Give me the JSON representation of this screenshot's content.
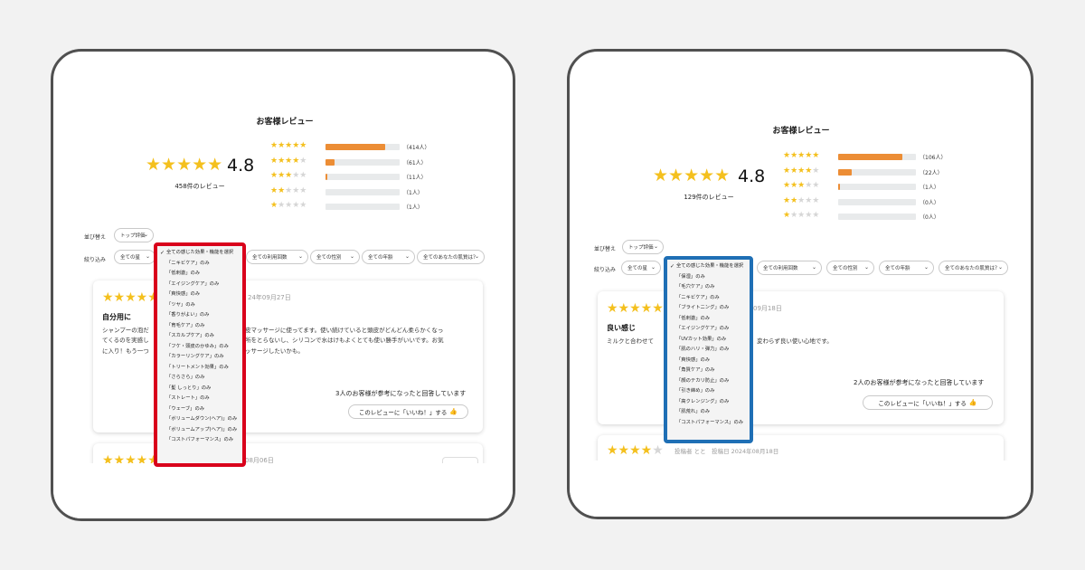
{
  "left": {
    "title": "お客様レビュー",
    "average": "4.8",
    "review_count": "458件のレビュー",
    "distribution": [
      {
        "stars": 5,
        "label": "（414人）",
        "fraction": 0.81
      },
      {
        "stars": 4,
        "label": "（61人）",
        "fraction": 0.12
      },
      {
        "stars": 3,
        "label": "（11人）",
        "fraction": 0.02
      },
      {
        "stars": 2,
        "label": "（1人）",
        "fraction": 0
      },
      {
        "stars": 1,
        "label": "（1人）",
        "fraction": 0
      }
    ],
    "sort_label": "並び替え",
    "sort_value": "トップ評価",
    "filter_label": "絞り込み",
    "filters": [
      "全ての星",
      "全ての利用回数",
      "全ての性別",
      "全ての年齢",
      "全てのあなたの肌質は？"
    ],
    "dropdown_items": [
      "全ての感じた効果・機能を選択",
      "「ニキビケア」のみ",
      "「低刺激」のみ",
      "「エイジングケア」のみ",
      "「爽快感」のみ",
      "「ツヤ」のみ",
      "「香りがよい」のみ",
      "「育毛ケア」のみ",
      "「スカルプケア」のみ",
      "「フケ・頭皮のかゆみ」のみ",
      "「カラーリングケア」のみ",
      "「トリートメント効果」のみ",
      "「さらさら」のみ",
      "「髪 しっとり」のみ",
      "「ストレート」のみ",
      "「ウェーブ」のみ",
      "「ボリュームダウン(ヘア)」のみ",
      "「ボリュームアップ(ヘア)」のみ",
      "「コストパフォーマンス」のみ"
    ],
    "review1": {
      "date": "24年09月27日",
      "title": "自分用に",
      "body_a": "シャンプーの泡だ",
      "body_b": "てくるのを実感し",
      "body_c": "に入り！もう一つ",
      "body_r1": "皮マッサージに使ってます。使い続けていると頭皮がどんどん柔らかくなっ",
      "body_r2": "所をとらないし、シリコンで水はけもよくとても使い勝手がいいです。お気",
      "body_r3": "ッサージしたいかも。",
      "helpful": "3人のお客様が参考になったと回答しています",
      "like": "このレビューに「いいね！」する",
      "rating": 5
    },
    "review2": {
      "date": "08月06日",
      "rating": 5
    }
  },
  "right": {
    "title": "お客様レビュー",
    "average": "4.8",
    "review_count": "129件のレビュー",
    "distribution": [
      {
        "stars": 5,
        "label": "（106人）",
        "fraction": 0.82
      },
      {
        "stars": 4,
        "label": "（22人）",
        "fraction": 0.17
      },
      {
        "stars": 3,
        "label": "（1人）",
        "fraction": 0.01
      },
      {
        "stars": 2,
        "label": "（0人）",
        "fraction": 0
      },
      {
        "stars": 1,
        "label": "（0人）",
        "fraction": 0
      }
    ],
    "sort_label": "並び替え",
    "sort_value": "トップ評価",
    "filter_label": "絞り込み",
    "filters": [
      "全ての星",
      "全ての利用回数",
      "全ての性別",
      "全ての年齢",
      "全てのあなたの肌質は？"
    ],
    "dropdown_items": [
      "全ての感じた効果・機能を選択",
      "「保湿」のみ",
      "「毛穴ケア」のみ",
      "「ニキビケア」のみ",
      "「ブライトニング」のみ",
      "「低刺激」のみ",
      "「エイジングケア」のみ",
      "「UVカット効果」のみ",
      "「肌のハリ・弾力」のみ",
      "「爽快感」のみ",
      "「角質ケア」のみ",
      "「顔のテカリ防止」のみ",
      "「引き締め」のみ",
      "「高クレンジング」のみ",
      "「肌荒れ」のみ",
      "「コストパフォーマンス」のみ"
    ],
    "review1": {
      "date": "09月18日",
      "title": "良い感じ",
      "body_a": "ミルクと合わせて",
      "body_r1": "変わらず良い使い心地です。",
      "helpful": "2人のお客様が参考になったと回答しています",
      "like": "このレビューに「いいね！」する",
      "rating": 5
    },
    "review2": {
      "author_date": "投稿者 とと　投稿日 2024年08月18日",
      "rating": 4
    }
  },
  "colors": {
    "star": "#f4c01e",
    "bar": "#ec8d35",
    "red_highlight": "#d9001b",
    "blue_highlight": "#1f6fb5"
  }
}
